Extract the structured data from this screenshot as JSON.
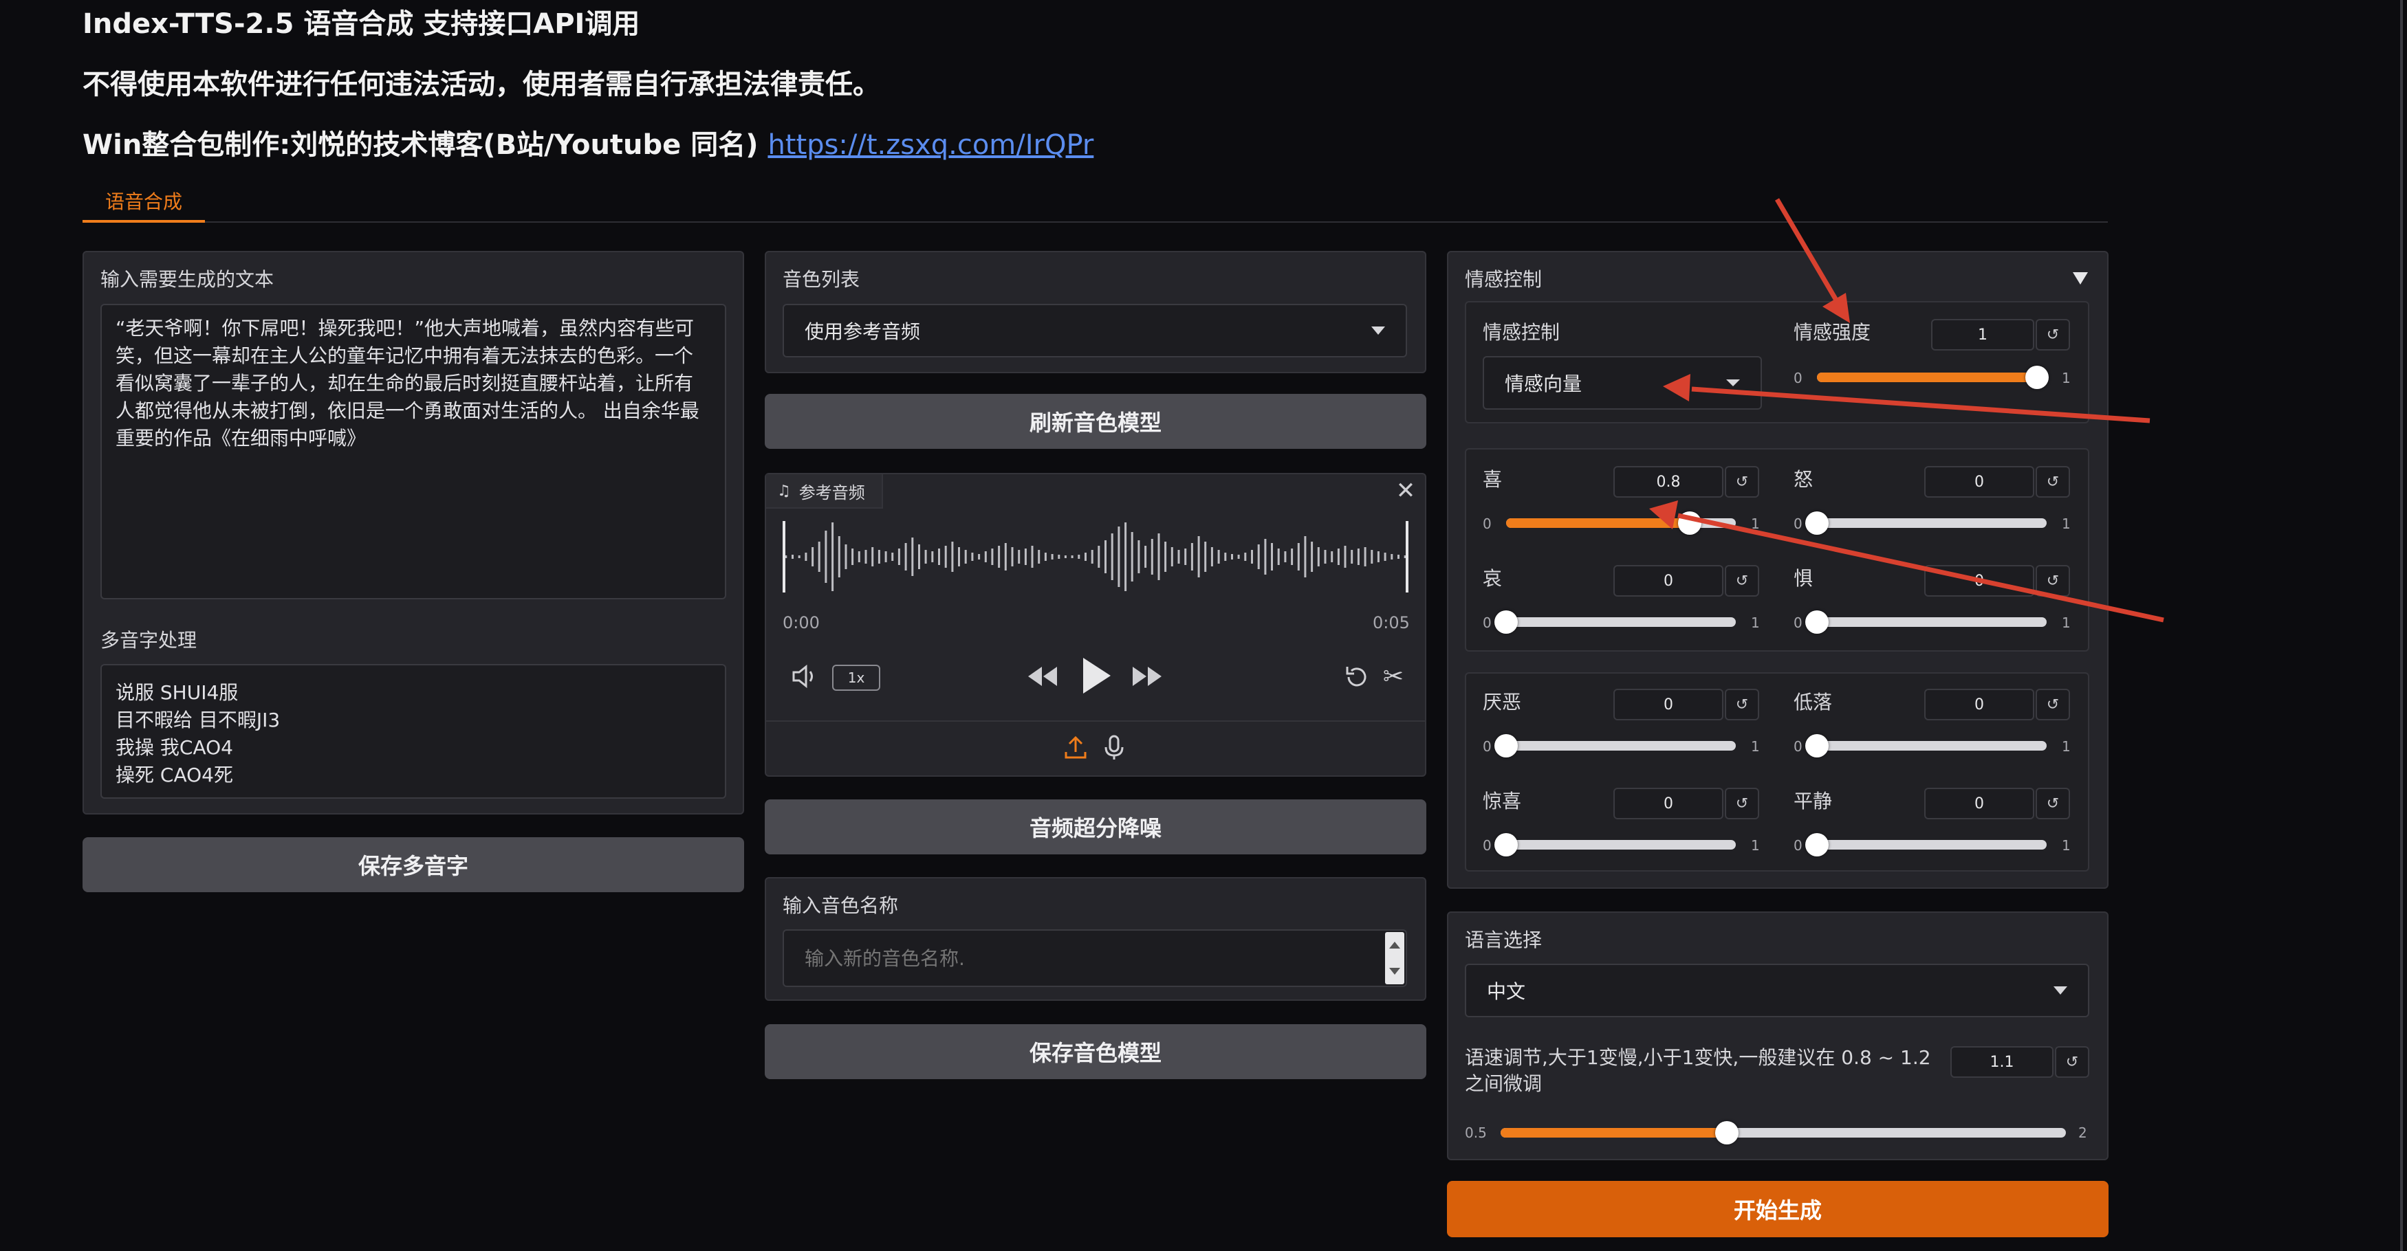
{
  "header": {
    "title": "Index-TTS-2.5 语音合成 支持接口API调用",
    "warning": "不得使用本软件进行任何违法活动，使用者需自行承担法律责任。",
    "credit": "Win整合包制作:刘悦的技术博客(B站/Youtube 同名)",
    "link": "https://t.zsxq.com/IrQPr"
  },
  "tabs": [
    {
      "label": "语音合成",
      "active": true
    }
  ],
  "text_input": {
    "label": "输入需要生成的文本",
    "value": "“老天爷啊！你下屌吧！操死我吧！”他大声地喊着，虽然内容有些可笑，但这一幕却在主人公的童年记忆中拥有着无法抹去的色彩。一个看似窝囊了一辈子的人，却在生命的最后时刻挺直腰杆站着，让所有人都觉得他从未被打倒，依旧是一个勇敢面对生活的人。 出自余华最重要的作品《在细雨中呼喊》"
  },
  "polyphone": {
    "label": "多音字处理",
    "lines": [
      "说服 SHUI4服",
      "目不暇给 目不暇JI3",
      "我操 我CAO4",
      "操死 CAO4死"
    ]
  },
  "save_polyphone_button": "保存多音字",
  "voice_list": {
    "label": "音色列表",
    "selected": "使用参考音频"
  },
  "refresh_voice_button": "刷新音色模型",
  "audio": {
    "label": "参考音频",
    "time_start": "0:00",
    "time_end": "0:05",
    "speed": "1x"
  },
  "denoise_button": "音频超分降噪",
  "voice_name": {
    "label": "输入音色名称",
    "placeholder": "输入新的音色名称."
  },
  "save_voice_button": "保存音色模型",
  "emotion": {
    "panel_label": "情感控制",
    "control_label": "情感控制",
    "control_selected": "情感向量",
    "strength_label": "情感强度",
    "strength_value": "1",
    "strength_min": "0",
    "strength_max": "1",
    "strength_fraction": 1.0,
    "sliders": [
      {
        "name": "喜",
        "value": "0.8",
        "fraction": 0.8,
        "min": "0",
        "max": "1"
      },
      {
        "name": "怒",
        "value": "0",
        "fraction": 0,
        "min": "0",
        "max": "1"
      },
      {
        "name": "哀",
        "value": "0",
        "fraction": 0,
        "min": "0",
        "max": "1"
      },
      {
        "name": "惧",
        "value": "0",
        "fraction": 0,
        "min": "0",
        "max": "1"
      },
      {
        "name": "厌恶",
        "value": "0",
        "fraction": 0,
        "min": "0",
        "max": "1"
      },
      {
        "name": "低落",
        "value": "0",
        "fraction": 0,
        "min": "0",
        "max": "1"
      },
      {
        "name": "惊喜",
        "value": "0",
        "fraction": 0,
        "min": "0",
        "max": "1"
      },
      {
        "name": "平静",
        "value": "0",
        "fraction": 0,
        "min": "0",
        "max": "1"
      }
    ]
  },
  "language": {
    "label": "语言选择",
    "selected": "中文"
  },
  "speed": {
    "label": "语速调节,大于1变慢,小于1变快,一般建议在 0.8 ~ 1.2 之间微调",
    "value": "1.1",
    "min": "0.5",
    "max": "2",
    "fraction": 0.4
  },
  "generate_button": "开始生成",
  "colors": {
    "accent": "#f07d1b",
    "button_gray": "#4a4a50",
    "generate": "#d9600a",
    "annotation": "#d8412f"
  }
}
